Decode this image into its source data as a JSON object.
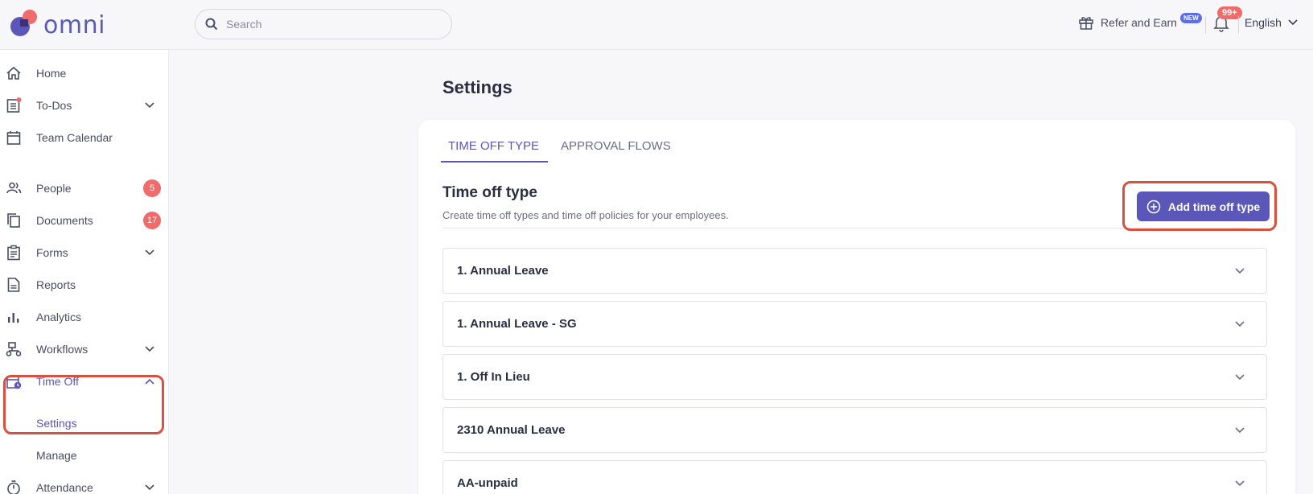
{
  "app": {
    "logo_text": "omni"
  },
  "search": {
    "placeholder": "Search"
  },
  "header": {
    "refer_label": "Refer and Earn",
    "new_badge": "NEW",
    "notification_count": "99+",
    "language": "English"
  },
  "sidebar": {
    "items": [
      {
        "label": "Home",
        "icon": "home-icon"
      },
      {
        "label": "To-Dos",
        "icon": "todo-icon"
      },
      {
        "label": "Team Calendar",
        "icon": "calendar-icon"
      },
      {
        "label": "People",
        "icon": "people-icon",
        "badge": "5"
      },
      {
        "label": "Documents",
        "icon": "documents-icon",
        "badge": "17"
      },
      {
        "label": "Forms",
        "icon": "forms-icon"
      },
      {
        "label": "Reports",
        "icon": "reports-icon"
      },
      {
        "label": "Analytics",
        "icon": "analytics-icon"
      },
      {
        "label": "Workflows",
        "icon": "workflows-icon"
      },
      {
        "label": "Time Off",
        "icon": "time-off-icon"
      },
      {
        "label": "Attendance",
        "icon": "stopwatch-icon"
      }
    ],
    "time_off_sub": {
      "settings": "Settings",
      "manage": "Manage"
    }
  },
  "main": {
    "page_title": "Settings",
    "tabs": [
      {
        "label": "TIME OFF TYPE",
        "active": true
      },
      {
        "label": "APPROVAL FLOWS",
        "active": false
      }
    ],
    "section_title": "Time off type",
    "section_desc": "Create time off types and time off policies for your employees.",
    "add_button": "Add time off type",
    "rows": [
      "1. Annual Leave",
      "1. Annual Leave - SG",
      "1. Off In Lieu",
      "2310 Annual Leave",
      "AA-unpaid"
    ]
  },
  "colors": {
    "accent": "#5b57b8",
    "badge": "#f26b6b",
    "highlight": "#d9503f"
  }
}
